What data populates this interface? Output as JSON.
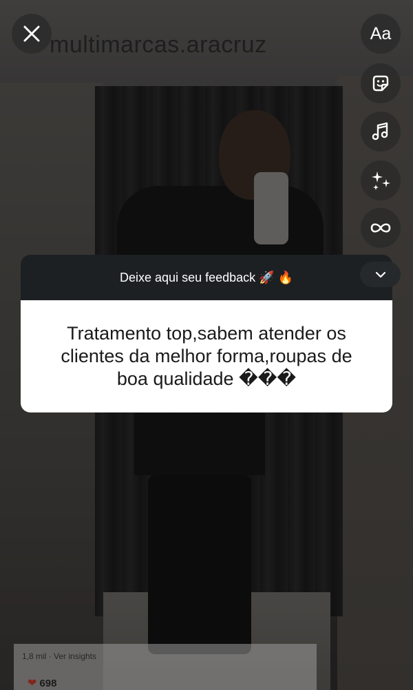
{
  "background": {
    "watermark_text": "multimarcas.aracruz",
    "post_meta": "1,8 mil · Ver insights",
    "post_likes": "698"
  },
  "story": {
    "close_icon": "close-icon",
    "tools": [
      {
        "name": "text-tool",
        "label": "Aa",
        "icon": "text-icon"
      },
      {
        "name": "sticker-tool",
        "icon": "sticker-icon"
      },
      {
        "name": "music-tool",
        "icon": "music-note-icon"
      },
      {
        "name": "effects-tool",
        "icon": "sparkles-icon"
      },
      {
        "name": "boomerang-tool",
        "icon": "infinity-icon"
      }
    ],
    "collapse_icon": "chevron-down-icon"
  },
  "question_card": {
    "prompt": "Deixe aqui seu feedback 🚀 🔥",
    "answer": "Tratamento top,sabem atender os clientes da melhor forma,roupas de boa qualidade ���"
  },
  "colors": {
    "card_header": "#1d2023",
    "card_body": "#ffffff",
    "tool_button": "#282828"
  }
}
